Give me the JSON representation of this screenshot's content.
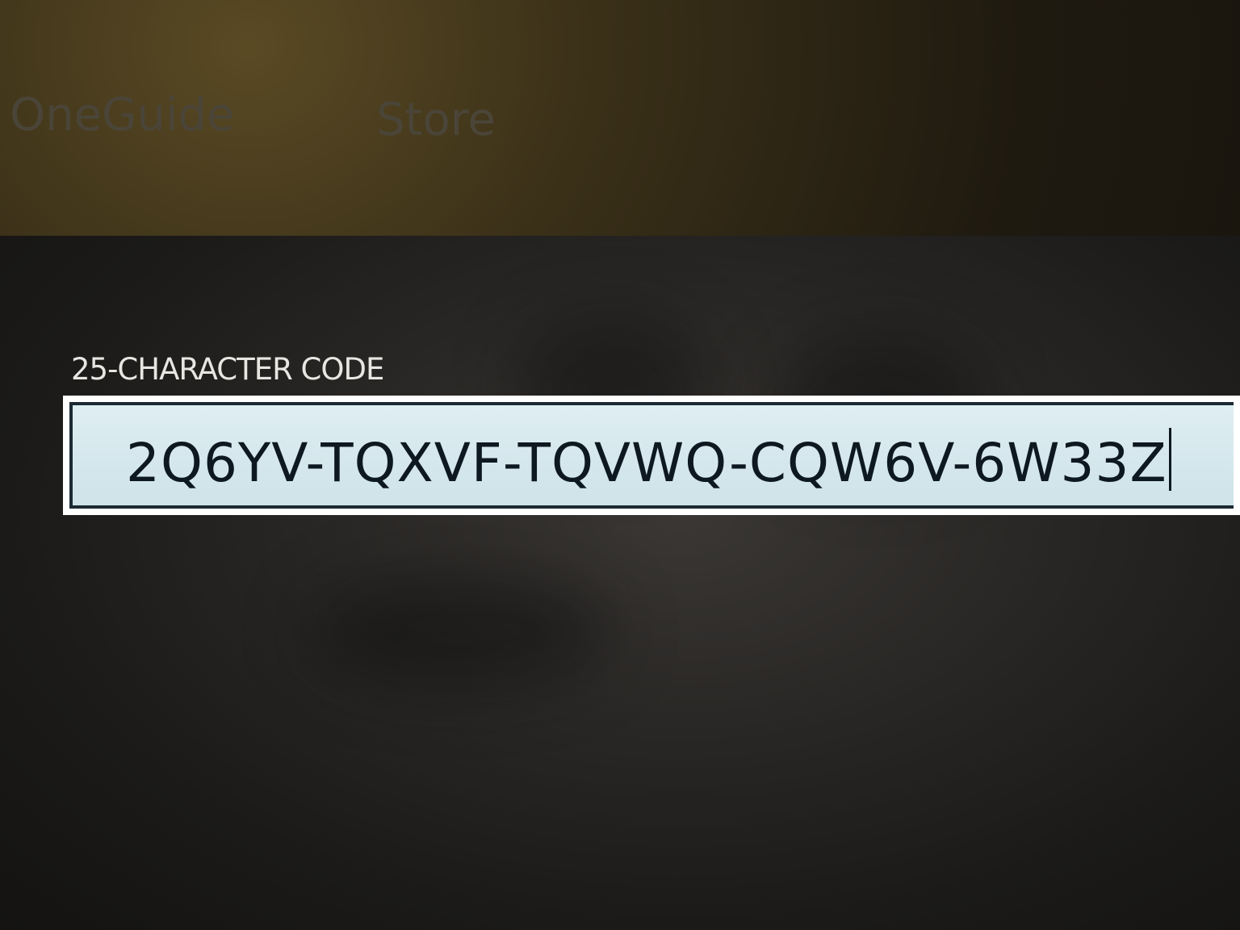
{
  "nav": {
    "tabs": [
      {
        "label": "OneGuide"
      },
      {
        "label": "Store"
      }
    ]
  },
  "redeem": {
    "field_label": "25-CHARACTER CODE",
    "code_value": "2Q6YV-TQXVF-TQVWQ-CQW6V-6W33Z"
  },
  "colors": {
    "background": "#12100c",
    "panel": "#2a2826",
    "input_fill": "#d6e8ed",
    "input_border": "#1c2a33",
    "text": "#e8e6e2"
  }
}
